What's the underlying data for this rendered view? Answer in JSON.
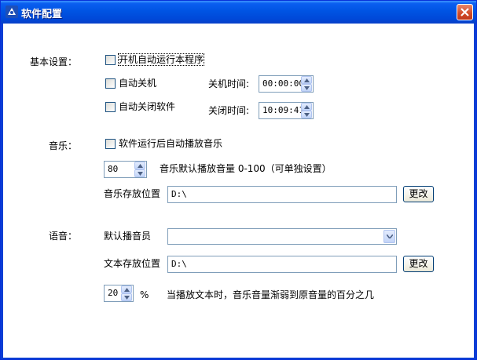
{
  "window": {
    "title": "软件配置"
  },
  "basic": {
    "label": "基本设置：",
    "autostart": {
      "label": "开机自动运行本程序",
      "checked": false
    },
    "autoshutdown": {
      "label": "自动关机",
      "checked": false,
      "time_label": "关机时间:",
      "time_value": "00:00:00"
    },
    "autoclose": {
      "label": "自动关闭软件",
      "checked": false,
      "time_label": "关闭时间:",
      "time_value": "10:09:41"
    }
  },
  "music": {
    "label": "音乐：",
    "autoplay": {
      "label": "软件运行后自动播放音乐",
      "checked": false
    },
    "volume_value": "80",
    "volume_desc": "音乐默认播放音量 0-100（可单独设置）",
    "folder_label": "音乐存放位置",
    "folder_value": "D:\\",
    "change_button": "更改"
  },
  "voice": {
    "label": "语音：",
    "announcer_label": "默认播音员",
    "announcer_value": "",
    "text_folder_label": "文本存放位置",
    "text_folder_value": "D:\\",
    "change_button": "更改",
    "fade_value": "20",
    "fade_unit": "%",
    "fade_desc": "当播放文本时，音乐音量渐弱到原音量的百分之几"
  }
}
